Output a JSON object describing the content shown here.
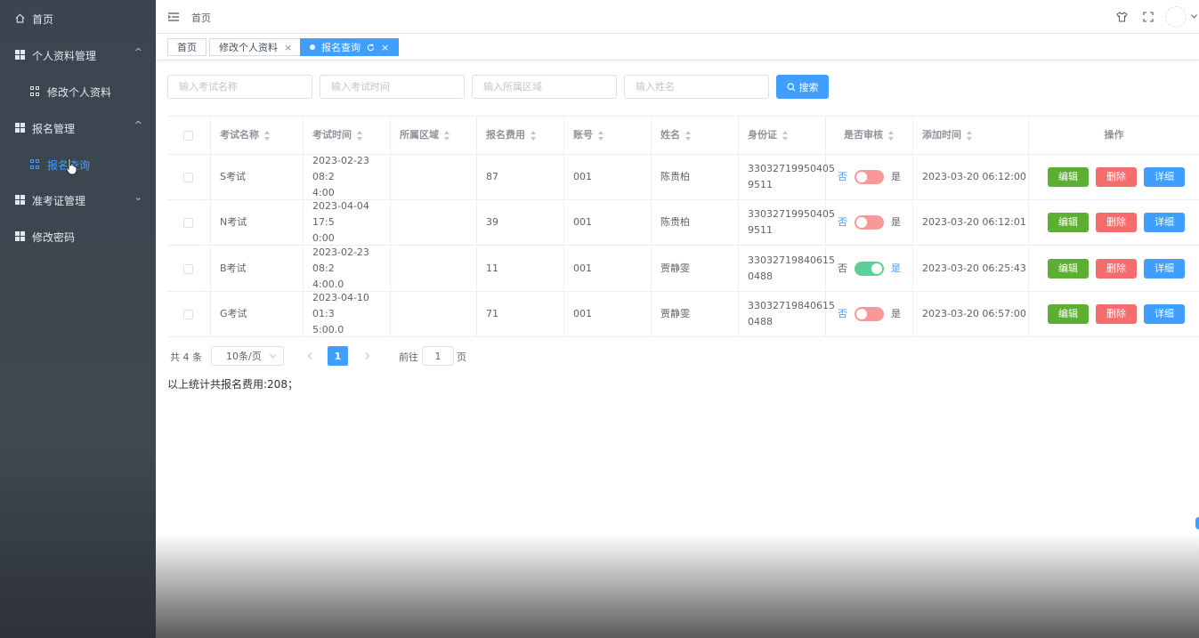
{
  "sidebar": {
    "items": [
      {
        "label": "首页",
        "icon": "home-icon"
      },
      {
        "label": "个人资料管理",
        "icon": "grid-icon",
        "arrow": "^"
      },
      {
        "label": "修改个人资料",
        "icon": "app-icon"
      },
      {
        "label": "报名管理",
        "icon": "grid-icon",
        "arrow": "^"
      },
      {
        "label": "报名查询",
        "icon": "app-icon"
      },
      {
        "label": "准考证管理",
        "icon": "grid-icon",
        "arrow": "⌄"
      },
      {
        "label": "修改密码",
        "icon": "grid-icon"
      }
    ]
  },
  "header": {
    "breadcrumb": "首页"
  },
  "tabs": [
    {
      "label": "首页"
    },
    {
      "label": "修改个人资料",
      "close": "×"
    },
    {
      "label": "报名查询",
      "close": "×"
    }
  ],
  "search": {
    "exam_name_placeholder": "输入考试名称",
    "exam_time_placeholder": "输入考试时间",
    "region_placeholder": "输入所属区域",
    "name_placeholder": "输入姓名",
    "button": "搜索"
  },
  "table": {
    "headers": [
      "考试名称",
      "考试时间",
      "所属区域",
      "报名费用",
      "账号",
      "姓名",
      "身份证",
      "是否审核",
      "添加时间",
      "操作"
    ],
    "rows": [
      {
        "exam": "S考试",
        "time1": "2023-02-23 08:2",
        "time2": "4:00",
        "region": "",
        "fee": "87",
        "account": "001",
        "name": "陈贵柏",
        "id1": "33032719950405",
        "id2": "9511",
        "off": "否",
        "on": "是",
        "approved": false,
        "added": "2023-03-20 06:12:00"
      },
      {
        "exam": "N考试",
        "time1": "2023-04-04 17:5",
        "time2": "0:00",
        "region": "",
        "fee": "39",
        "account": "001",
        "name": "陈贵柏",
        "id1": "33032719950405",
        "id2": "9511",
        "off": "否",
        "on": "是",
        "approved": false,
        "added": "2023-03-20 06:12:01"
      },
      {
        "exam": "B考试",
        "time1": "2023-02-23 08:2",
        "time2": "4:00.0",
        "region": "",
        "fee": "11",
        "account": "001",
        "name": "贾静雯",
        "id1": "33032719840615",
        "id2": "0488",
        "off": "否",
        "on": "是",
        "approved": true,
        "added": "2023-03-20 06:25:43"
      },
      {
        "exam": "G考试",
        "time1": "2023-04-10 01:3",
        "time2": "5:00.0",
        "region": "",
        "fee": "71",
        "account": "001",
        "name": "贾静雯",
        "id1": "33032719840615",
        "id2": "0488",
        "off": "否",
        "on": "是",
        "approved": false,
        "added": "2023-03-20 06:57:00"
      }
    ],
    "actions": {
      "edit": "编辑",
      "delete": "删除",
      "detail": "详细"
    }
  },
  "pagination": {
    "total": "共 4 条",
    "page_size": "10条/页",
    "current": "1",
    "goto_prefix": "前往",
    "goto_value": "1",
    "goto_suffix": "页"
  },
  "summary": "以上统计共报名费用:208；",
  "colors": {
    "primary": "#409eff",
    "success": "#5daf34",
    "danger": "#f56c6c",
    "switch_on": "#5fce98",
    "switch_off": "#f89898"
  }
}
